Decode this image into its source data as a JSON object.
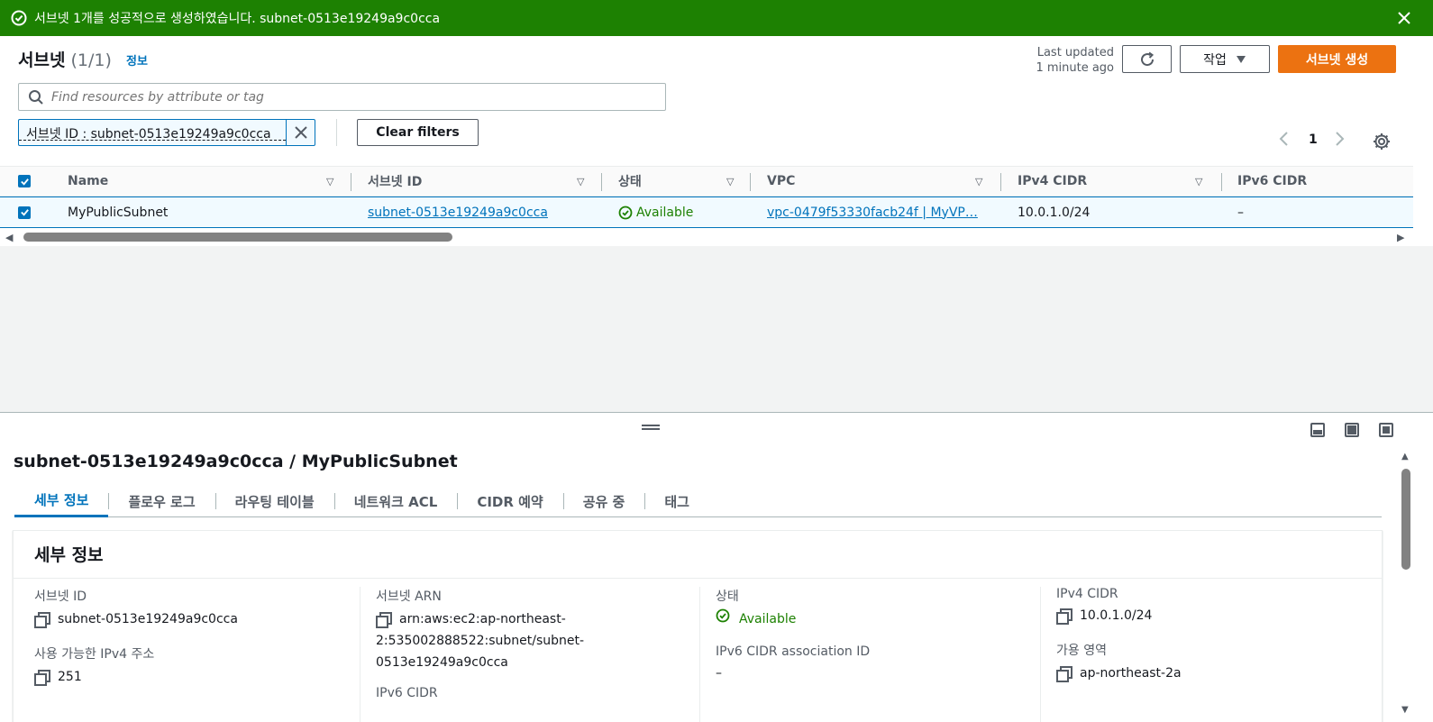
{
  "flash": {
    "message": "서브넷 1개를 성공적으로 생성하였습니다. subnet-0513e19249a9c0cca",
    "color": "#1d8102"
  },
  "header": {
    "title": "서브넷",
    "count": "(1/1)",
    "info_link": "정보",
    "last_updated_1": "Last updated",
    "last_updated_2": "1 minute ago",
    "actions_label": "작업",
    "create_label": "서브넷 생성",
    "accent": "#ec7211"
  },
  "search": {
    "placeholder": "Find resources by attribute or tag"
  },
  "filter": {
    "token": "서브넷 ID : subnet-0513e19249a9c0cca",
    "clear_label": "Clear filters"
  },
  "pagination": {
    "page": "1"
  },
  "table": {
    "headers": [
      "Name",
      "서브넷 ID",
      "상태",
      "VPC",
      "IPv4 CIDR",
      "IPv6 CIDR"
    ],
    "rows": [
      {
        "name": "MyPublicSubnet",
        "subnet_id": "subnet-0513e19249a9c0cca",
        "status": "Available",
        "vpc": "vpc-0479f53330facb24f | MyVP…",
        "ipv4": "10.0.1.0/24",
        "ipv6": "–"
      }
    ]
  },
  "details": {
    "title": "subnet-0513e19249a9c0cca / MyPublicSubnet",
    "tabs": [
      "세부 정보",
      "플로우 로그",
      "라우팅 테이블",
      "네트워크 ACL",
      "CIDR 예약",
      "공유 중",
      "태그"
    ],
    "section_title": "세부 정보",
    "fields": {
      "subnet_id_label": "서브넷 ID",
      "subnet_id": "subnet-0513e19249a9c0cca",
      "avail_ipv4_label": "사용 가능한 IPv4 주소",
      "avail_ipv4": "251",
      "arn_label": "서브넷 ARN",
      "arn_1": "arn:aws:ec2:ap-northeast-",
      "arn_2": "2:535002888522:subnet/subnet-",
      "arn_3": "0513e19249a9c0cca",
      "ipv6_cidr_label": "IPv6 CIDR",
      "state_label": "상태",
      "state": "Available",
      "ipv6_assoc_label": "IPv6 CIDR association ID",
      "ipv6_assoc": "–",
      "ipv4_cidr_label": "IPv4 CIDR",
      "ipv4_cidr": "10.0.1.0/24",
      "az_label": "가용 영역",
      "az": "ap-northeast-2a"
    }
  }
}
